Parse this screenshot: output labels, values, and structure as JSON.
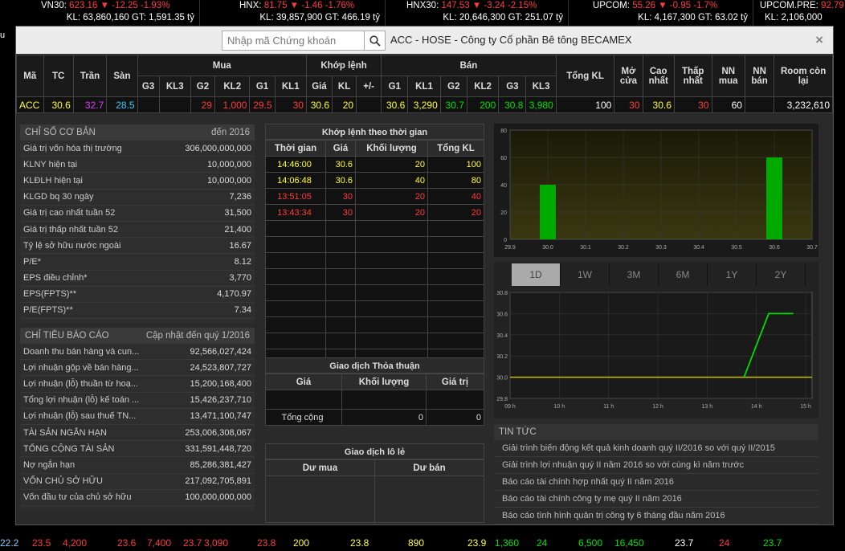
{
  "topbar": [
    {
      "name": "VN30:",
      "val": "623.16",
      "chg": "-12.25",
      "pct": "-1.93%",
      "kl": "KL: 63,860,160 GT: 1,591.35 tỷ"
    },
    {
      "name": "HNX:",
      "val": "81.75",
      "chg": "-1.46",
      "pct": "-1.76%",
      "kl": "KL: 39,857,900 GT: 466.19 tỷ"
    },
    {
      "name": "HNX30:",
      "val": "147.53",
      "chg": "-3.24",
      "pct": "-2.15%",
      "kl": "KL: 20,646,300 GT: 251.07 tỷ"
    },
    {
      "name": "UPCOM:",
      "val": "55.26",
      "chg": "-0.95",
      "pct": "-1.7%",
      "kl": "KL: 4,167,300 GT: 63.02 tỷ"
    },
    {
      "name": "UPCOM.PRE:",
      "val": "92.79",
      "chg": "",
      "pct": "",
      "kl": "KL: 2,106,000"
    }
  ],
  "modal": {
    "search_placeholder": "Nhập mã Chứng khoán",
    "title": "ACC - HOSE - Công ty Cổ phần Bê tông BECAMEX",
    "close": "×"
  },
  "quote": {
    "headers": {
      "ma": "Mã",
      "tc": "TC",
      "tran": "Trần",
      "san": "Sàn",
      "mua": "Mua",
      "khop": "Khớp lệnh",
      "ban": "Bán",
      "tongkl": "Tổng KL",
      "mocua": "Mở cửa",
      "caonhat": "Cao nhất",
      "thapnhat": "Thấp nhất",
      "nnmua": "NN mua",
      "nnban": "NN bán",
      "room": "Room còn lại"
    },
    "sub": [
      "G3",
      "KL3",
      "G2",
      "KL2",
      "G1",
      "KL1",
      "Giá",
      "KL",
      "+/-",
      "G1",
      "KL1",
      "G2",
      "KL2",
      "G3",
      "KL3"
    ],
    "row": {
      "ma": "ACC",
      "tc": "30.6",
      "tran": "32.7",
      "san": "28.5",
      "g3": "",
      "kl3": "",
      "g2": "29",
      "kl2": "1,000",
      "g1": "29.5",
      "kl1": "30",
      "gia": "30.6",
      "kl": "20",
      "pm": "",
      "bg1": "30.6",
      "bkl1": "3,290",
      "bg2": "30.7",
      "bkl2": "200",
      "bg3": "30.8",
      "bkl3": "3,980",
      "tongkl": "100",
      "mocua": "30",
      "caonhat": "30.6",
      "thapnhat": "30",
      "nnmua": "60",
      "nnban": "",
      "room": "3,232,610"
    }
  },
  "chiso": {
    "title": "CHỈ SỐ CƠ BẢN",
    "right": "đến 2016",
    "rows": [
      [
        "Giá trị vốn hóa thị trường",
        "306,000,000,000"
      ],
      [
        "KLNY hiện tại",
        "10,000,000"
      ],
      [
        "KLĐLH hiện tại",
        "10,000,000"
      ],
      [
        "KLGD bq 30 ngày",
        "7,236"
      ],
      [
        "Giá trị cao nhất tuần 52",
        "31,500"
      ],
      [
        "Giá trị thấp nhất tuần 52",
        "21,400"
      ],
      [
        "Tỷ lệ sở hữu nước ngoài",
        "16.67"
      ],
      [
        "P/E*",
        "8.12"
      ],
      [
        "EPS điều chỉnh*",
        "3,770"
      ],
      [
        "EPS(FPTS)**",
        "4,170.97"
      ],
      [
        "P/E(FPTS)**",
        "7.34"
      ]
    ]
  },
  "chitieu": {
    "title": "CHỈ TIÊU BÁO CÁO",
    "right": "Cập nhật đến quý 1/2016",
    "rows": [
      [
        "Doanh thu bán hàng và cun...",
        "92,566,027,424"
      ],
      [
        "Lợi nhuận gộp về bán hàng...",
        "24,523,807,727"
      ],
      [
        "Lợi nhuận (lỗ) thuần từ hoạ...",
        "15,200,168,400"
      ],
      [
        "Tổng lợi nhuận (lỗ) kế toán ...",
        "15,426,237,710"
      ],
      [
        "Lợi nhuận (lỗ) sau thuế TN...",
        "13,471,100,747"
      ],
      [
        "TÀI SẢN NGẮN HẠN",
        "253,006,308,067"
      ],
      [
        "TỔNG CỘNG TÀI SẢN",
        "331,591,448,720"
      ],
      [
        "Nợ ngắn hạn",
        "85,286,381,427"
      ],
      [
        "VỐN CHỦ SỞ HỮU",
        "217,092,705,891"
      ],
      [
        "Vốn đầu tư của chủ sở hữu",
        "100,000,000,000"
      ]
    ]
  },
  "khoplenh": {
    "title": "Khớp lệnh theo thời gian",
    "cols": [
      "Thời gian",
      "Giá",
      "Khối lượng",
      "Tổng KL"
    ],
    "rows": [
      [
        "14:46:00",
        "30.6",
        "20",
        "100",
        "yel"
      ],
      [
        "14:06:48",
        "30.6",
        "40",
        "80",
        "yel"
      ],
      [
        "13:51:05",
        "30",
        "20",
        "40",
        "red"
      ],
      [
        "13:43:34",
        "30",
        "20",
        "20",
        "red"
      ]
    ]
  },
  "thoathuan": {
    "title": "Giao dịch Thỏa thuận",
    "cols": [
      "Giá",
      "Khối lượng",
      "Giá trị"
    ],
    "total_label": "Tổng cộng",
    "total_kl": "0",
    "total_gt": "0"
  },
  "lole": {
    "title": "Giao dịch lô lẻ",
    "cols": [
      "Dư mua",
      "Dư bán"
    ]
  },
  "tabs": [
    "1D",
    "1W",
    "3M",
    "6M",
    "1Y",
    "2Y"
  ],
  "chart_data": [
    {
      "type": "bar",
      "x": [
        30.0,
        30.6
      ],
      "values": [
        40,
        60
      ],
      "xticks": [
        "29.9",
        "30.0",
        "30.1",
        "30.2",
        "30.3",
        "30.4",
        "30.5",
        "30.6",
        "30.7"
      ],
      "yticks": [
        "0",
        "20",
        "40",
        "60",
        "80"
      ],
      "xlim": [
        29.9,
        30.7
      ],
      "ylim": [
        0,
        80
      ],
      "color": "#00aa00"
    },
    {
      "type": "line",
      "x": [
        "13:45",
        "14:15",
        "14:45"
      ],
      "values": [
        30.0,
        30.6,
        30.6
      ],
      "reference": 30.0,
      "xticks": [
        "09 h",
        "10 h",
        "11 h",
        "12 h",
        "13 h",
        "14 h",
        "15 h"
      ],
      "yticks": [
        "29.8",
        "30.0",
        "30.2",
        "30.4",
        "30.6",
        "30.8"
      ],
      "ylim": [
        29.8,
        30.8
      ],
      "color": "#00dd00"
    }
  ],
  "tintuc": {
    "title": "TIN TỨC",
    "items": [
      "Giải trình biến động kết quả kinh doanh quý II/2016 so với quý II/2015",
      "Giải trình lợi nhuận quý II năm 2016 so với cùng kì năm trước",
      "Báo cáo tài chính hợp nhất quý II năm 2016",
      "Báo cáo tài chính công ty mẹ quý II năm 2016",
      "Báo cáo tình hình quản trị công ty 6 tháng đầu năm 2016"
    ]
  },
  "bottom": [
    "22.2",
    "23.5",
    "4,200",
    "23.6",
    "7,400",
    "23.7",
    "3,090",
    "23.8",
    "200",
    "23.8",
    "890",
    "23.9",
    "1,360",
    "24",
    "6,500",
    "16,450",
    "23.7",
    "24",
    "23.7"
  ]
}
